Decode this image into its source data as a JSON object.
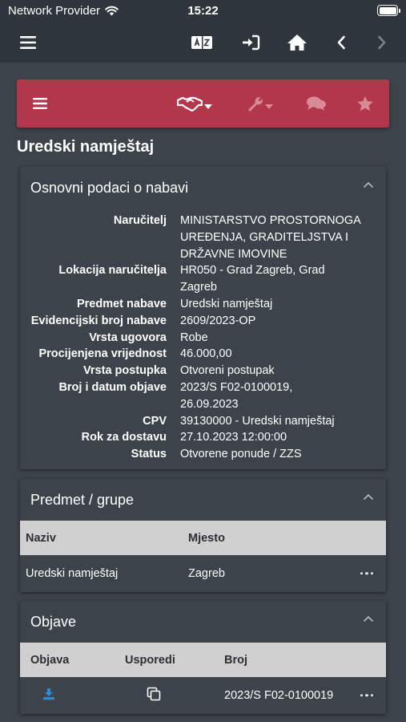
{
  "status_bar": {
    "carrier": "Network Provider",
    "time": "15:22"
  },
  "app_bar": {
    "icons": [
      "menu-icon",
      "translate-icon",
      "login-icon",
      "home-icon",
      "back-icon",
      "forward-icon"
    ]
  },
  "toolbar": {
    "icons": [
      "menu-icon",
      "handshake-icon",
      "wrench-icon",
      "comments-icon",
      "star-icon"
    ],
    "colors": {
      "background": "#b3374a",
      "active": "#ffffff",
      "inactive": "#d88a96"
    }
  },
  "page": {
    "title": "Uredski namještaj"
  },
  "basic": {
    "header": "Osnovni podaci o nabavi",
    "rows": [
      {
        "label": "Naručitelj",
        "lines": [
          "MINISTARSTVO PROSTORNOGA",
          "UREĐENJA, GRADITELJSTVA I",
          "DRŽAVNE IMOVINE"
        ]
      },
      {
        "label": "Lokacija naručitelja",
        "lines": [
          "HR050 - Grad Zagreb, Grad",
          "Zagreb"
        ]
      },
      {
        "label": "Predmet nabave",
        "lines": [
          "Uredski namještaj"
        ]
      },
      {
        "label": "Evidencijski broj nabave",
        "lines": [
          "2609/2023-OP"
        ]
      },
      {
        "label": "Vrsta ugovora",
        "lines": [
          "Robe"
        ]
      },
      {
        "label": "Procijenjena vrijednost",
        "lines": [
          "46.000,00"
        ]
      },
      {
        "label": "Vrsta postupka",
        "lines": [
          "Otvoreni postupak"
        ]
      },
      {
        "label": "Broj i datum objave",
        "lines": [
          "2023/S F02-0100019,",
          "26.09.2023"
        ]
      },
      {
        "label": "CPV",
        "lines": [
          "39130000 - Uredski namještaj"
        ]
      },
      {
        "label": "Rok za dostavu",
        "lines": [
          "27.10.2023 12:00:00"
        ]
      },
      {
        "label": "Status",
        "lines": [
          "Otvorene ponude / ZZS"
        ]
      }
    ]
  },
  "groups": {
    "header": "Predmet / grupe",
    "columns": [
      "Naziv",
      "Mjesto"
    ],
    "rows": [
      {
        "naziv": "Uredski namještaj",
        "mjesto": "Zagreb"
      }
    ]
  },
  "notices": {
    "header": "Objave",
    "columns": [
      "Objava",
      "Usporedi",
      "Broj"
    ],
    "rows": [
      {
        "broj": "2023/S F02-0100019"
      }
    ]
  }
}
